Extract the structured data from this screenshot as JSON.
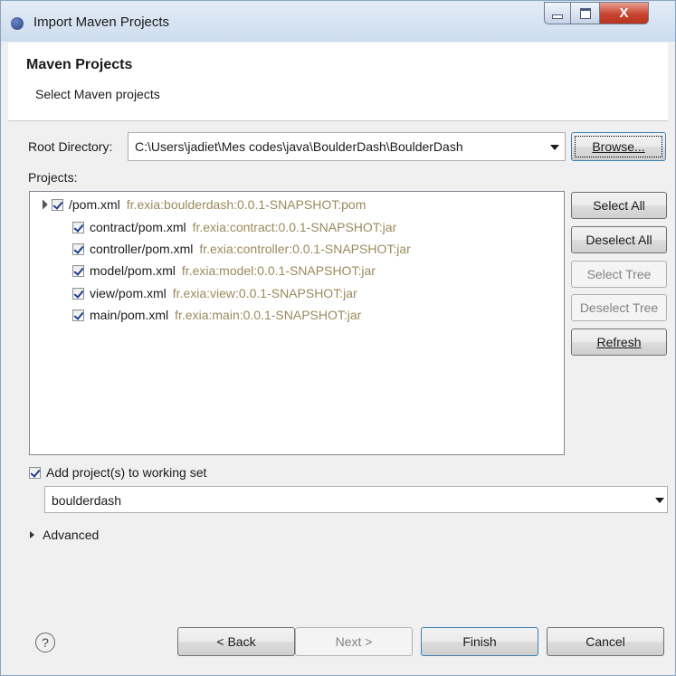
{
  "window": {
    "title": "Import Maven Projects",
    "close_glyph": "X"
  },
  "header": {
    "title": "Maven Projects",
    "subtitle": "Select Maven projects"
  },
  "root_directory": {
    "label": "Root Directory:",
    "value": "C:\\Users\\jadiet\\Mes codes\\java\\BoulderDash\\BoulderDash",
    "browse_label": "Browse..."
  },
  "projects": {
    "label": "Projects:",
    "items": [
      {
        "path": "/pom.xml",
        "gav": "fr.exia:boulderdash:0.0.1-SNAPSHOT:pom",
        "checked": true
      },
      {
        "path": "contract/pom.xml",
        "gav": "fr.exia:contract:0.0.1-SNAPSHOT:jar",
        "checked": true
      },
      {
        "path": "controller/pom.xml",
        "gav": "fr.exia:controller:0.0.1-SNAPSHOT:jar",
        "checked": true
      },
      {
        "path": "model/pom.xml",
        "gav": "fr.exia:model:0.0.1-SNAPSHOT:jar",
        "checked": true
      },
      {
        "path": "view/pom.xml",
        "gav": "fr.exia:view:0.0.1-SNAPSHOT:jar",
        "checked": true
      },
      {
        "path": "main/pom.xml",
        "gav": "fr.exia:main:0.0.1-SNAPSHOT:jar",
        "checked": true
      }
    ]
  },
  "side_buttons": {
    "select_all": "Select All",
    "deselect_all": "Deselect All",
    "select_tree": "Select Tree",
    "deselect_tree": "Deselect Tree",
    "refresh": "Refresh"
  },
  "working_set": {
    "label": "Add project(s) to working set",
    "checked": true,
    "value": "boulderdash"
  },
  "advanced": {
    "label": "Advanced"
  },
  "footer": {
    "help": "?",
    "back": "< Back",
    "next": "Next >",
    "finish": "Finish",
    "cancel": "Cancel"
  }
}
